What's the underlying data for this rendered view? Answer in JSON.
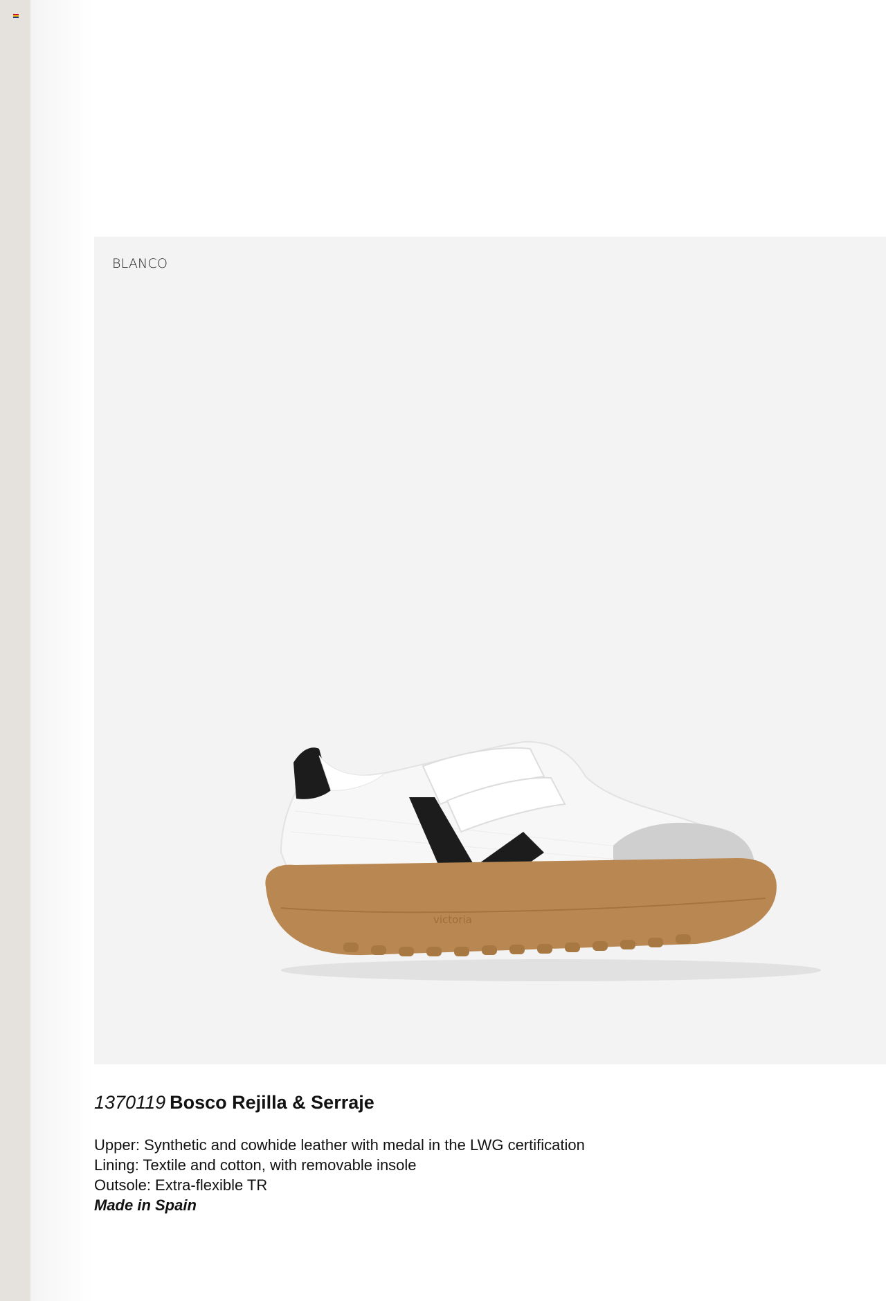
{
  "colors": {
    "sidebar": "#e5e1dc",
    "photo_background": "#f3f3f3",
    "sole": "#b98852",
    "stripe": "#1c1c1c"
  },
  "sidebar": {
    "icon": "flag-icon"
  },
  "product": {
    "color_name": "BLANCO",
    "code": "1370119",
    "name": "Bosco Rejilla & Serraje",
    "sole_brand": "victoria",
    "specs": {
      "upper": "Upper: Synthetic and cowhide leather with medal in the LWG certification",
      "lining": "Lining: Textile and cotton, with removable insole",
      "outsole": "Outsole: Extra-flexible TR",
      "origin": "Made in Spain"
    }
  }
}
